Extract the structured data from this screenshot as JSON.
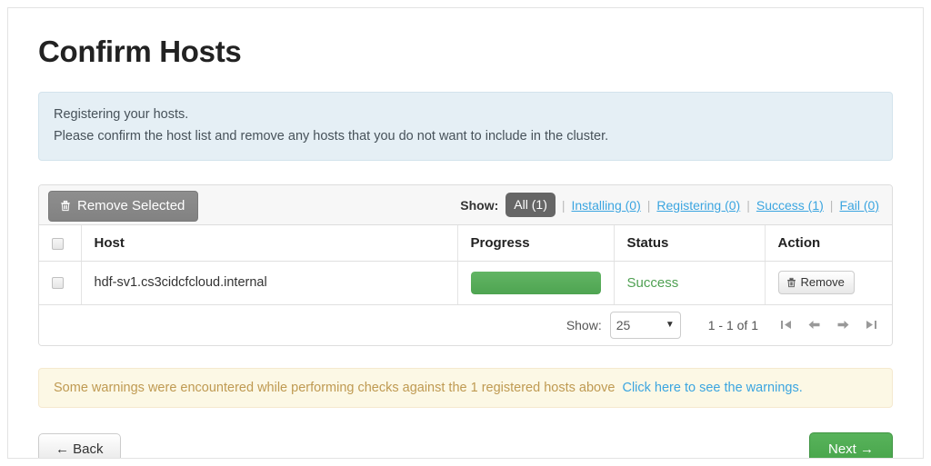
{
  "page": {
    "title": "Confirm Hosts"
  },
  "info_alert": {
    "line1": "Registering your hosts.",
    "line2": "Please confirm the host list and remove any hosts that you do not want to include in the cluster."
  },
  "toolbar": {
    "remove_selected_label": "Remove Selected",
    "remove_selected_icon": "trash-icon",
    "show_label": "Show:",
    "separator": "|",
    "filters": [
      {
        "label": "All (1)",
        "active": true
      },
      {
        "label": "Installing (0)",
        "active": false
      },
      {
        "label": "Registering (0)",
        "active": false
      },
      {
        "label": "Success (1)",
        "active": false
      },
      {
        "label": "Fail (0)",
        "active": false
      }
    ]
  },
  "table": {
    "columns": [
      "",
      "Host",
      "Progress",
      "Status",
      "Action"
    ],
    "rows": [
      {
        "host": "hdf-sv1.cs3cidcfcloud.internal",
        "progress_percent": 100,
        "status": "Success",
        "action_label": "Remove",
        "action_icon": "trash-icon",
        "selected": false
      }
    ]
  },
  "pagination": {
    "show_label": "Show:",
    "page_size": "25",
    "caret_icon": "chevron-down-icon",
    "range_text": "1 - 1 of 1",
    "arrows": [
      {
        "name": "first-page",
        "glyph": "⏮"
      },
      {
        "name": "previous-page",
        "glyph": "←"
      },
      {
        "name": "next-page",
        "glyph": "→"
      },
      {
        "name": "last-page",
        "glyph": "⏭"
      }
    ]
  },
  "warning_alert": {
    "text": "Some warnings were encountered while performing checks against the 1 registered hosts above",
    "link_text": "Click here to see the warnings."
  },
  "bottom_nav": {
    "back_label": "← Back",
    "next_label": "Next →"
  },
  "colors": {
    "accent_link": "#3ba5e0",
    "success_green": "#4fa052",
    "progress_green": "#56ac58",
    "warning_text": "#bf9a52",
    "info_bg": "#e5eff5",
    "warning_bg": "#fcf8e5",
    "filter_badge_bg": "#666666",
    "remove_selected_bg": "#888888"
  }
}
